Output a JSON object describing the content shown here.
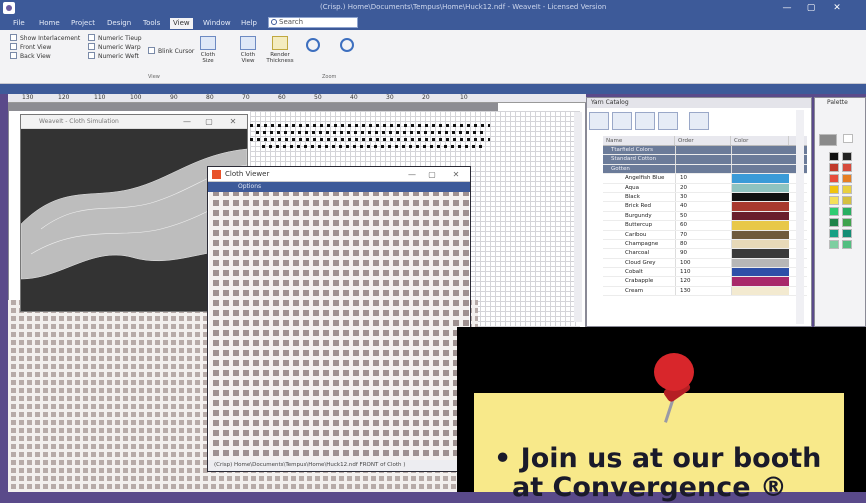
{
  "window": {
    "title": "(Crisp.) Home\\Documents\\Tempus\\Home\\Huck12.ndf - WeaveIt - Licensed Version",
    "minimize": "—",
    "maximize": "▢",
    "close": "✕"
  },
  "menu": {
    "items": [
      "File",
      "Home",
      "Project",
      "Design",
      "Tools",
      "View",
      "Window",
      "Help"
    ],
    "active": "View",
    "search_placeholder": "Search"
  },
  "ribbon": {
    "checks_col1": [
      "Show Interlacement",
      "Front View",
      "Back View"
    ],
    "checks_col2": [
      "Numeric Tieup",
      "Numeric Warp",
      "Numeric Weft"
    ],
    "blink": "Blink Cursor",
    "buttons": [
      {
        "label": "Cloth Size"
      },
      {
        "label": "Cloth View"
      },
      {
        "label": "Render Thickness"
      }
    ],
    "group_view": "View",
    "group_zoom": "Zoom"
  },
  "ruler": {
    "ticks": [
      "130",
      "120",
      "110",
      "100",
      "90",
      "80",
      "70",
      "60",
      "50",
      "40",
      "30",
      "20",
      "10"
    ]
  },
  "sim_window": {
    "title": "WeaveIt - Cloth Simulation"
  },
  "cloth_viewer": {
    "title": "Cloth Viewer",
    "options": "Options",
    "status": "(Crisp) Home\\Documents\\Tempus\\Home\\Huck12.ndf    FRONT of Cloth )"
  },
  "yarn_catalog": {
    "title": "Yarn Catalog",
    "headers": [
      "Name",
      "Order",
      "Color"
    ],
    "groups": [
      "Ttarfield Colors",
      "Standard Cotton",
      "Gotten"
    ],
    "rows": [
      {
        "name": "Angelfish Blue",
        "order": "10",
        "color": "#3a9bd8"
      },
      {
        "name": "Aqua",
        "order": "20",
        "color": "#8ec3c0"
      },
      {
        "name": "Black",
        "order": "30",
        "color": "#111111"
      },
      {
        "name": "Brick Red",
        "order": "40",
        "color": "#a8392e"
      },
      {
        "name": "Burgundy",
        "order": "50",
        "color": "#6a1e2c"
      },
      {
        "name": "Buttercup",
        "order": "60",
        "color": "#e8c848"
      },
      {
        "name": "Caribou",
        "order": "70",
        "color": "#6f5a3c"
      },
      {
        "name": "Champagne",
        "order": "80",
        "color": "#e7d9b8"
      },
      {
        "name": "Charcoal",
        "order": "90",
        "color": "#3a3a3a"
      },
      {
        "name": "Cloud Grey",
        "order": "100",
        "color": "#b7b7b7"
      },
      {
        "name": "Cobalt",
        "order": "110",
        "color": "#2d4fa8"
      },
      {
        "name": "Crabapple",
        "order": "120",
        "color": "#a8286a"
      },
      {
        "name": "Cream",
        "order": "130",
        "color": "#f3ead0"
      }
    ]
  },
  "palette": {
    "title": "Palette",
    "colors": [
      "#8a8a8a",
      "#ffffff",
      "#111111",
      "#222222",
      "#c0392b",
      "#d64a3b",
      "#e74c3c",
      "#e67e22",
      "#f1c40f",
      "#e8d040",
      "#f5e05a",
      "#d4c040",
      "#2ecc71",
      "#27ae60",
      "#1e8449",
      "#3fa34d",
      "#16a085",
      "#138d75",
      "#7dcea0",
      "#52be80"
    ]
  },
  "promo": {
    "line1": "• Join us at our booth",
    "line2": "at Convergence ®"
  }
}
